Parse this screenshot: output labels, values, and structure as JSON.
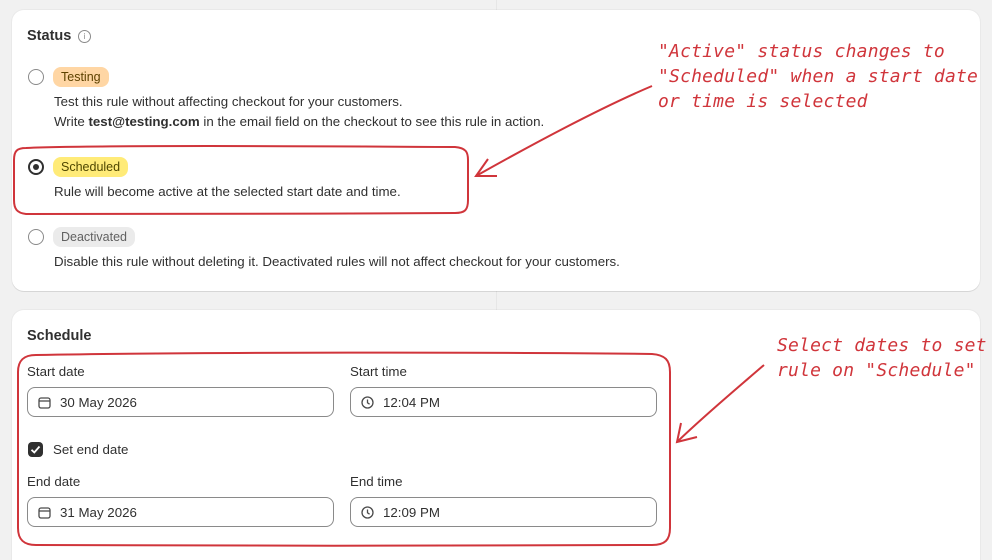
{
  "status_section": {
    "title": "Status",
    "info_icon": "info-icon",
    "options": [
      {
        "badge": "Testing",
        "desc_lines": [
          "Test this rule without affecting checkout for your customers."
        ],
        "desc2_pre": "Write ",
        "desc2_email": "test@testing.com",
        "desc2_post": " in the email field on the checkout to see this rule in action.",
        "selected": false
      },
      {
        "badge": "Scheduled",
        "desc": "Rule will become active at the selected start date and time.",
        "selected": true
      },
      {
        "badge": "Deactivated",
        "desc": "Disable this rule without deleting it. Deactivated rules will not affect checkout for your customers.",
        "selected": false
      }
    ]
  },
  "schedule_section": {
    "title": "Schedule",
    "start_date_label": "Start date",
    "start_date_value": "30 May 2026",
    "start_time_label": "Start time",
    "start_time_value": "12:04 PM",
    "set_end_date_label": "Set end date",
    "set_end_date_checked": true,
    "end_date_label": "End date",
    "end_date_value": "31 May 2026",
    "end_time_label": "End time",
    "end_time_value": "12:09 PM"
  },
  "annotations": {
    "status_note": [
      "\"Active\" status changes to",
      "\"Scheduled\" when a start date",
      "or time is selected"
    ],
    "schedule_note": [
      "Select dates to set",
      "rule on \"Schedule\""
    ]
  },
  "colors": {
    "annotation": "#d0353b",
    "badge_testing": "#ffd6a4",
    "badge_scheduled": "#ffeb78",
    "badge_deactivated": "#ebebeb"
  }
}
